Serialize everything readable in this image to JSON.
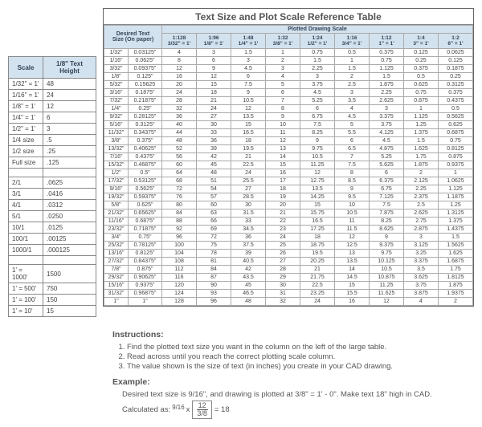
{
  "small_table": {
    "headers": [
      "Scale",
      "1/8\" Text Height"
    ],
    "groups": [
      [
        [
          "1/32\" = 1'",
          "48"
        ],
        [
          "1/16\" = 1'",
          "24"
        ],
        [
          "1/8\" = 1'",
          "12"
        ],
        [
          "1/4\" = 1'",
          "6"
        ],
        [
          "1/2\" = 1'",
          "3"
        ],
        [
          "1/4 size",
          ".5"
        ],
        [
          "1/2 size",
          ".25"
        ],
        [
          "Full size",
          ".125"
        ]
      ],
      [
        [
          "2/1",
          ".0625"
        ],
        [
          "3/1",
          ".0416"
        ],
        [
          "4/1",
          ".0312"
        ],
        [
          "5/1",
          ".0250"
        ],
        [
          "10/1",
          ".0125"
        ],
        [
          "100/1",
          ".00125"
        ],
        [
          "1000/1",
          ".000125"
        ]
      ],
      [
        [
          "1' = 1000'",
          "1500"
        ],
        [
          "1' = 500'",
          "750"
        ],
        [
          "1' = 100'",
          "150"
        ],
        [
          "1' = 10'",
          "15"
        ]
      ]
    ]
  },
  "big_table": {
    "title": "Text Size and Plot Scale Reference Table",
    "span_header": "Plotted Drawing Scale",
    "left_header_top": "Desired Text",
    "left_header_bot": "Size (On paper)",
    "scale_headers": [
      {
        "top": "1:128",
        "bot": "3/32\" = 1'"
      },
      {
        "top": "1:96",
        "bot": "1/8\" = 1'"
      },
      {
        "top": "1:48",
        "bot": "1/4\" = 1'"
      },
      {
        "top": "1:32",
        "bot": "3/8\" = 1'"
      },
      {
        "top": "1:24",
        "bot": "1/2\" = 1'"
      },
      {
        "top": "1:16",
        "bot": "3/4\" = 1'"
      },
      {
        "top": "1:12",
        "bot": "1\" = 1'"
      },
      {
        "top": "1:4",
        "bot": "3\" = 1'"
      },
      {
        "top": "1:2",
        "bot": "6\" = 1'"
      }
    ],
    "rows": [
      [
        "1/32\"",
        "0.03125\"",
        "4",
        "3",
        "1.5",
        "1",
        "0.75",
        "0.5",
        "0.375",
        "0.125",
        "0.0625"
      ],
      [
        "1/16\"",
        "0.0625\"",
        "8",
        "6",
        "3",
        "2",
        "1.5",
        "1",
        "0.75",
        "0.25",
        "0.125"
      ],
      [
        "3/32\"",
        "0.09375\"",
        "12",
        "9",
        "4.5",
        "3",
        "2.25",
        "1.5",
        "1.125",
        "0.375",
        "0.1875"
      ],
      [
        "1/8\"",
        "0.125\"",
        "16",
        "12",
        "6",
        "4",
        "3",
        "2",
        "1.5",
        "0.5",
        "0.25"
      ],
      [
        "5/32\"",
        "0.15625",
        "20",
        "15",
        "7.5",
        "5",
        "3.75",
        "2.5",
        "1.875",
        "0.625",
        "0.3125"
      ],
      [
        "3/16\"",
        "0.1875\"",
        "24",
        "18",
        "9",
        "6",
        "4.5",
        "3",
        "2.25",
        "0.75",
        "0.375"
      ],
      [
        "7/32\"",
        "0.21875\"",
        "28",
        "21",
        "10.5",
        "7",
        "5.25",
        "3.5",
        "2.625",
        "0.875",
        "0.4375"
      ],
      [
        "1/4\"",
        "0.25\"",
        "32",
        "24",
        "12",
        "8",
        "6",
        "4",
        "3",
        "1",
        "0.5"
      ],
      [
        "9/32\"",
        "0.28125\"",
        "36",
        "27",
        "13.5",
        "9",
        "6.75",
        "4.5",
        "3.375",
        "1.125",
        "0.5625"
      ],
      [
        "5/16\"",
        "0.3125\"",
        "40",
        "30",
        "15",
        "10",
        "7.5",
        "5",
        "3.75",
        "1.25",
        "0.625"
      ],
      [
        "11/32\"",
        "0.34375\"",
        "44",
        "33",
        "16.5",
        "11",
        "8.25",
        "5.5",
        "4.125",
        "1.375",
        "0.6875"
      ],
      [
        "3/8\"",
        "0.375\"",
        "48",
        "36",
        "18",
        "12",
        "9",
        "6",
        "4.5",
        "1.5",
        "0.75"
      ],
      [
        "13/32\"",
        "0.40625\"",
        "52",
        "39",
        "19.5",
        "13",
        "9.75",
        "6.5",
        "4.875",
        "1.625",
        "0.8125"
      ],
      [
        "7/16\"",
        "0.4375\"",
        "56",
        "42",
        "21",
        "14",
        "10.5",
        "7",
        "5.25",
        "1.75",
        "0.875"
      ],
      [
        "15/32\"",
        "0.46875\"",
        "60",
        "45",
        "22.5",
        "15",
        "11.25",
        "7.5",
        "5.625",
        "1.875",
        "0.9375"
      ],
      [
        "1/2\"",
        "0.5\"",
        "64",
        "48",
        "24",
        "16",
        "12",
        "8",
        "6",
        "2",
        "1"
      ],
      [
        "17/32\"",
        "0.53125\"",
        "68",
        "51",
        "25.5",
        "17",
        "12.75",
        "8.5",
        "6.375",
        "2.125",
        "1.0625"
      ],
      [
        "9/16\"",
        "0.5625\"",
        "72",
        "54",
        "27",
        "18",
        "13.5",
        "9",
        "6.75",
        "2.25",
        "1.125"
      ],
      [
        "19/32\"",
        "0.59375\"",
        "76",
        "57",
        "28.5",
        "19",
        "14.25",
        "9.5",
        "7.125",
        "2.375",
        "1.1875"
      ],
      [
        "5/8\"",
        "0.625\"",
        "80",
        "60",
        "30",
        "20",
        "15",
        "10",
        "7.5",
        "2.5",
        "1.25"
      ],
      [
        "21/32\"",
        "0.65625\"",
        "84",
        "63",
        "31.5",
        "21",
        "15.75",
        "10.5",
        "7.875",
        "2.625",
        "1.3125"
      ],
      [
        "11/16\"",
        "0.6875\"",
        "88",
        "66",
        "33",
        "22",
        "16.5",
        "11",
        "8.25",
        "2.75",
        "1.375"
      ],
      [
        "23/32\"",
        "0.71875\"",
        "92",
        "69",
        "34.5",
        "23",
        "17.25",
        "11.5",
        "8.625",
        "2.875",
        "1.4375"
      ],
      [
        "3/4\"",
        "0.75\"",
        "96",
        "72",
        "36",
        "24",
        "18",
        "12",
        "9",
        "3",
        "1.5"
      ],
      [
        "25/32\"",
        "0.78125\"",
        "100",
        "75",
        "37.5",
        "25",
        "18.75",
        "12.5",
        "9.375",
        "3.125",
        "1.5625"
      ],
      [
        "13/16\"",
        "0.8125\"",
        "104",
        "78",
        "39",
        "26",
        "19.5",
        "13",
        "9.75",
        "3.25",
        "1.625"
      ],
      [
        "27/32\"",
        "0.84375\"",
        "108",
        "81",
        "40.5",
        "27",
        "20.25",
        "13.5",
        "10.125",
        "3.375",
        "1.6875"
      ],
      [
        "7/8\"",
        "0.875\"",
        "112",
        "84",
        "42",
        "28",
        "21",
        "14",
        "10.5",
        "3.5",
        "1.75"
      ],
      [
        "29/32\"",
        "0.90625\"",
        "116",
        "87",
        "43.5",
        "29",
        "21.75",
        "14.5",
        "10.875",
        "3.625",
        "1.8125"
      ],
      [
        "15/16\"",
        "0.9375\"",
        "120",
        "90",
        "45",
        "30",
        "22.5",
        "15",
        "11.25",
        "3.75",
        "1.875"
      ],
      [
        "31/32\"",
        "0.96875\"",
        "124",
        "93",
        "46.5",
        "31",
        "23.25",
        "15.5",
        "11.625",
        "3.875",
        "1.9375"
      ],
      [
        "1\"",
        "1\"",
        "128",
        "96",
        "48",
        "32",
        "24",
        "16",
        "12",
        "4",
        "2"
      ]
    ]
  },
  "instructions": {
    "heading": "Instructions:",
    "items": [
      "Find the plotted text size you want in the column on the left of the large table.",
      "Read across until you reach the correct plotting scale column.",
      "The value shown is the size of text (in inches) you create in your CAD drawing."
    ]
  },
  "example": {
    "heading": "Example:",
    "line1": "Desired text size is 9/16\", and drawing is plotted at 3/8\" = 1' - 0\". Make text 18\" high in CAD.",
    "calc_prefix": "Calculated as: ",
    "calc_frac_lead": "9/16",
    "calc_num": "12",
    "calc_den": "3/8",
    "calc_suffix": " = 18"
  }
}
